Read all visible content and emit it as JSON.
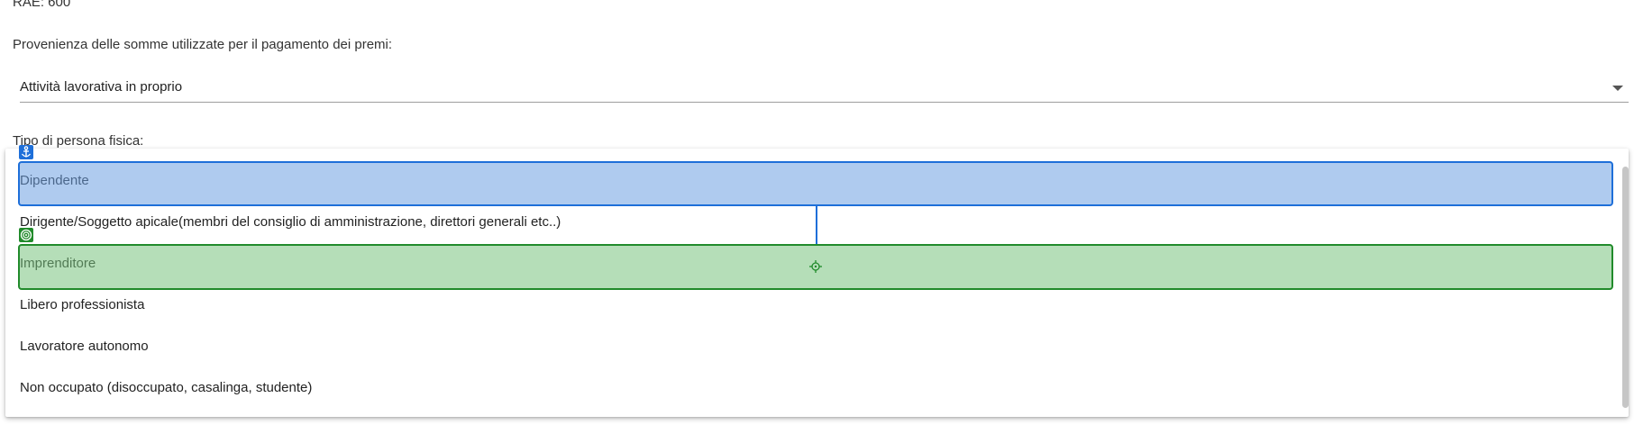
{
  "rae": {
    "label": "RAE: 600"
  },
  "provenienza": {
    "label": "Provenienza delle somme utilizzate per il pagamento dei premi:",
    "selected_value": "Attività lavorativa in proprio"
  },
  "tipo_persona": {
    "label": "Tipo di persona fisica:",
    "options": [
      "Dipendente",
      "Dirigente/Soggetto apicale(membri del consiglio di amministrazione, direttori generali etc..)",
      "Imprenditore",
      "Libero professionista",
      "Lavoratore autonomo",
      "Non occupato (disoccupato, casalinga, studente)"
    ]
  },
  "overlay": {
    "anchor_icon": "anchor-icon",
    "target_icon": "target-icon",
    "crosshair_icon": "crosshair-icon",
    "colors": {
      "anchor": "#1e6fd9",
      "target": "#218b2b"
    }
  }
}
